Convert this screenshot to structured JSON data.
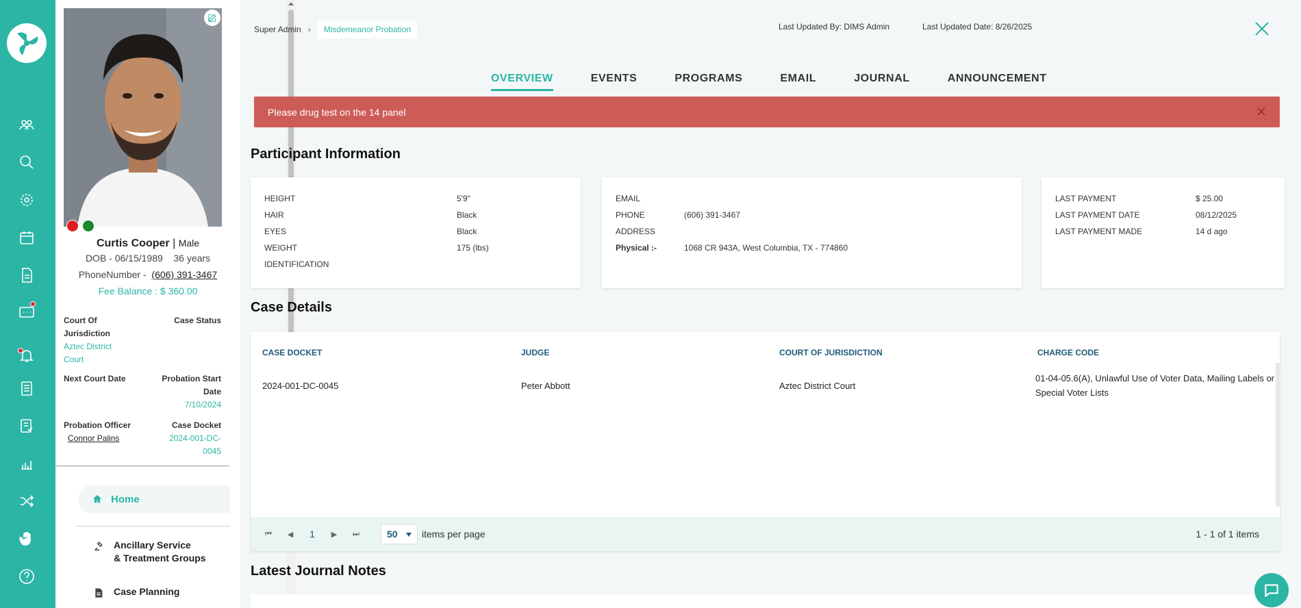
{
  "app": {
    "accent": "#2bb5a5",
    "alert_color": "#cd5c57"
  },
  "rail": {
    "icons": [
      "logo-icon",
      "users-icon",
      "search-icon",
      "gear-icon",
      "calendar-icon",
      "document-icon",
      "chat-icon",
      "bell-icon",
      "checklist-icon",
      "report-icon",
      "chart-icon",
      "shuffle-icon",
      "hand-icon",
      "help-icon",
      "more-icon"
    ]
  },
  "profile": {
    "name": "Curtis Cooper",
    "gender": "Male",
    "dob": "DOB - 06/15/1989",
    "age": "36 years",
    "phone_label": "PhoneNumber -",
    "phone": "(606) 391-3467",
    "fee_balance": "Fee Balance : $ 360.00",
    "court_label": "Court Of Jurisdiction",
    "court_value": "Aztec District Court",
    "case_status_label": "Case Status",
    "next_court_label": "Next Court Date",
    "probation_start_label": "Probation Start Date",
    "probation_start_value": "7/10/2024",
    "officer_label": "Probation Officer",
    "officer_value": "Connor Palins",
    "case_docket_label": "Case Docket",
    "case_docket_value": "2024-001-DC-0045"
  },
  "nav": {
    "home": "Home",
    "ancillary_1": "Ancillary Service",
    "ancillary_2": "& Treatment Groups",
    "case_planning": "Case Planning"
  },
  "header": {
    "crumb_root": "Super Admin",
    "crumb_current": "Misdemeanor Probation",
    "last_updated_by": "Last Updated By: DIMS Admin",
    "last_updated_date": "Last Updated Date: 8/26/2025"
  },
  "tabs": [
    "OVERVIEW",
    "EVENTS",
    "PROGRAMS",
    "EMAIL",
    "JOURNAL",
    "ANNOUNCEMENT"
  ],
  "alert": {
    "text": "Please drug test on the 14 panel"
  },
  "participant": {
    "title": "Participant Information",
    "physical": [
      {
        "label": "HEIGHT",
        "value": "5'9\""
      },
      {
        "label": "HAIR",
        "value": "Black"
      },
      {
        "label": "EYES",
        "value": "Black"
      },
      {
        "label": "WEIGHT",
        "value": "175 (lbs)"
      },
      {
        "label": "IDENTIFICATION",
        "value": ""
      }
    ],
    "contact": {
      "email_label": "EMAIL",
      "email": "",
      "phone_label": "PHONE",
      "phone": "(606) 391-3467",
      "address_label": "ADDRESS",
      "physical_label": "Physical :-",
      "physical": "1068 CR 943A, West Columbia, TX - 774860"
    },
    "payment": [
      {
        "label": "LAST PAYMENT",
        "value": "$ 25.00"
      },
      {
        "label": "LAST PAYMENT DATE",
        "value": "08/12/2025"
      },
      {
        "label": "LAST PAYMENT MADE",
        "value": "14 d ago"
      }
    ]
  },
  "case_details": {
    "title": "Case Details",
    "columns": [
      "CASE DOCKET",
      "JUDGE",
      "COURT OF JURISDICTION",
      "CHARGE CODE"
    ],
    "rows": [
      [
        "2024-001-DC-0045",
        "Peter Abbott",
        "Aztec District Court",
        "01-04-05.6(A), Unlawful Use of Voter Data, Mailing Labels or Special Voter Lists"
      ]
    ],
    "page": "1",
    "per_page": "50",
    "per_page_label": "items per page",
    "count": "1 - 1 of 1 items"
  },
  "journal": {
    "title": "Latest Journal Notes"
  }
}
